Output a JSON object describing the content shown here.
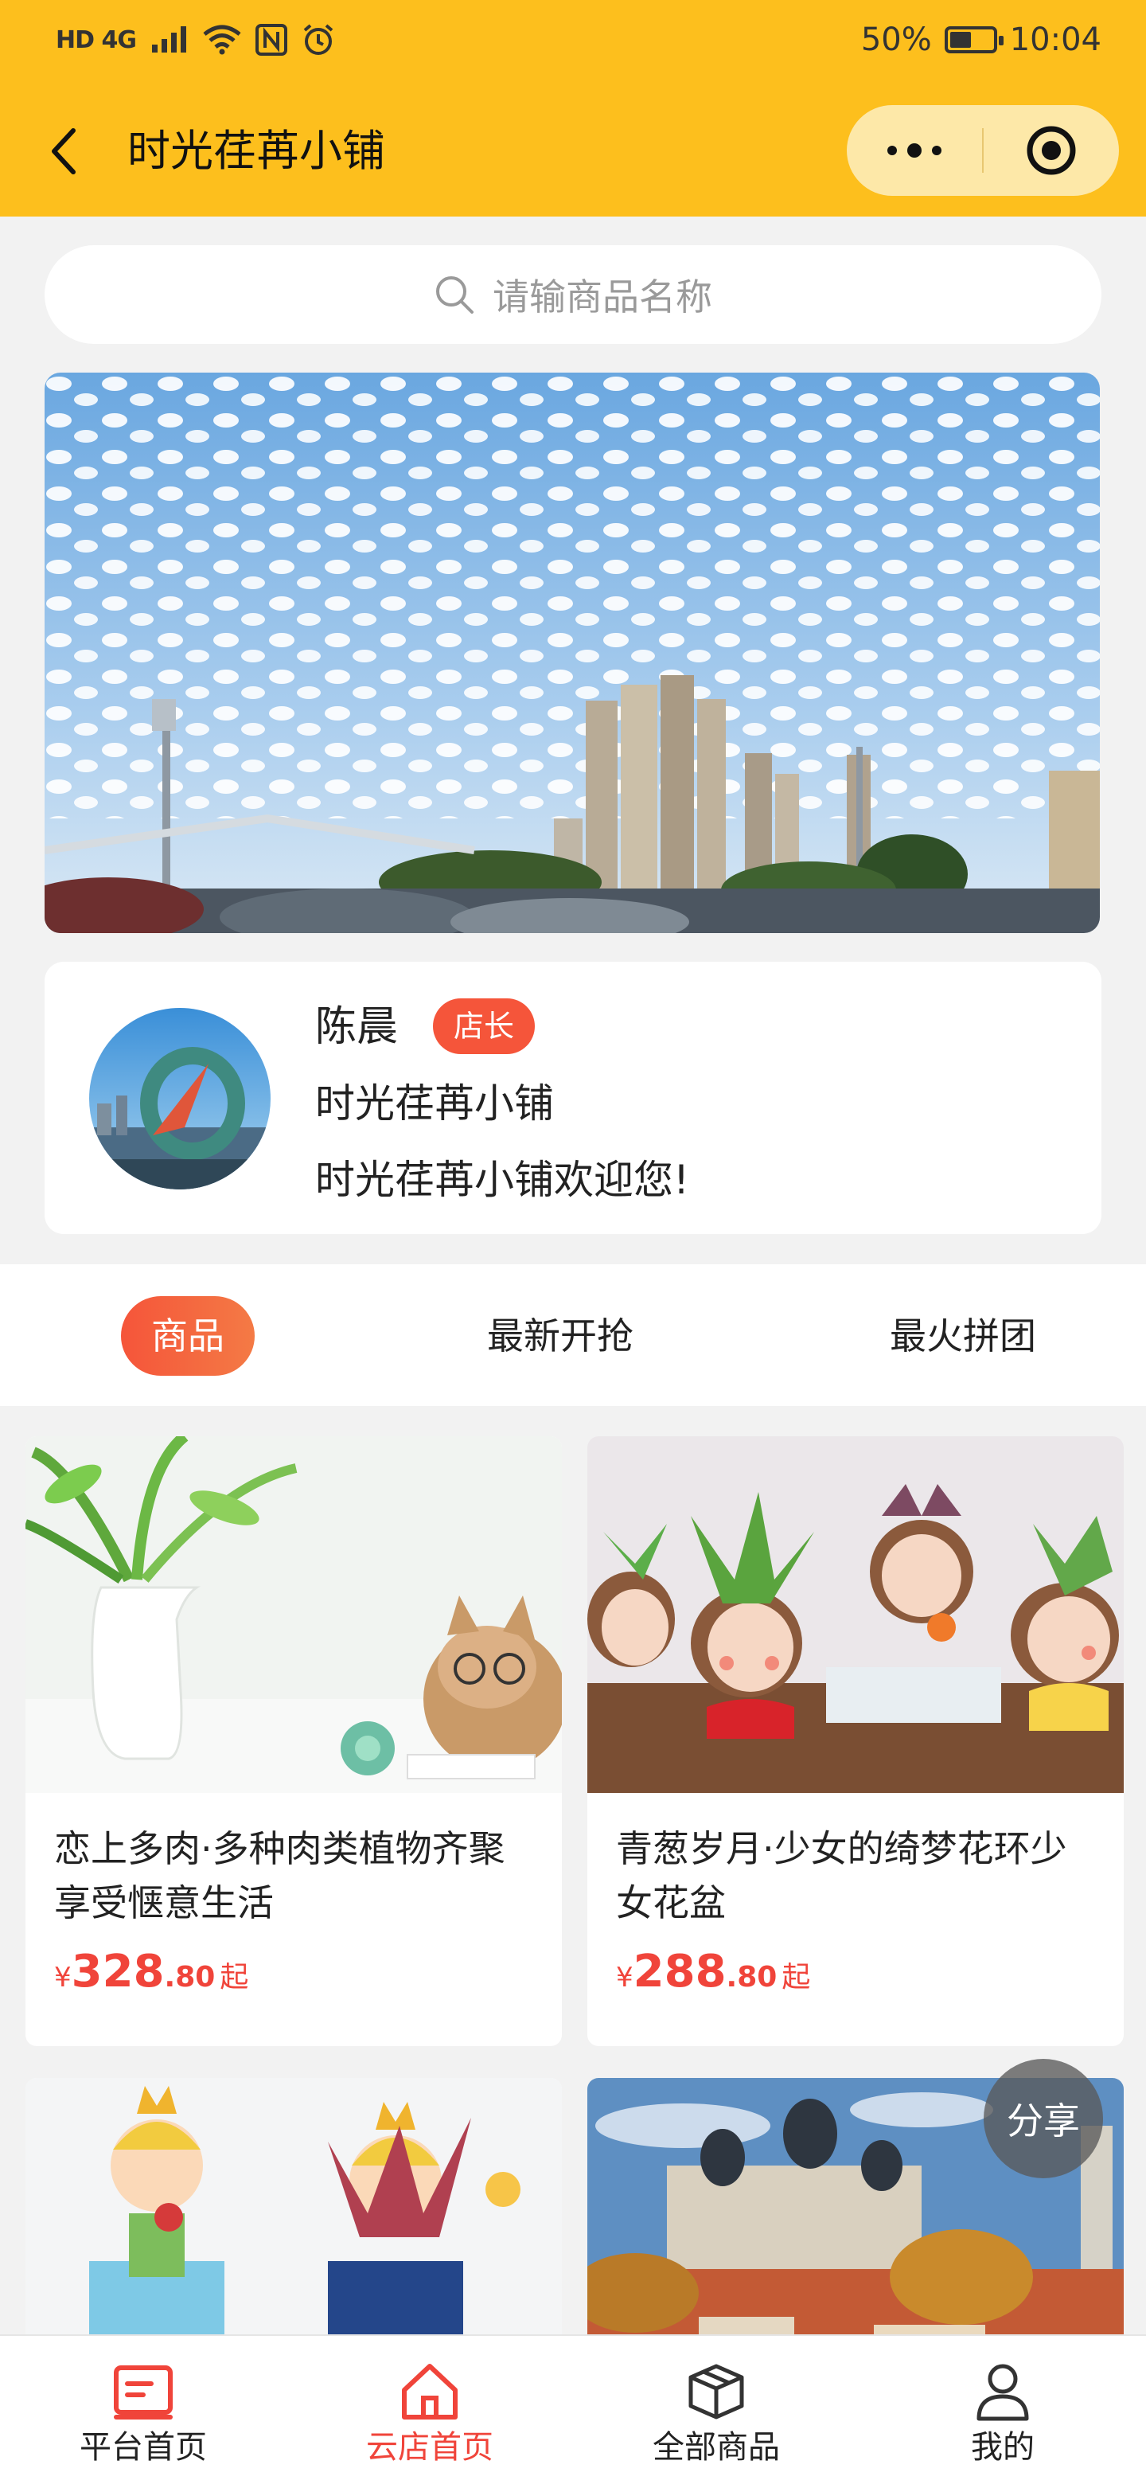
{
  "status_bar": {
    "network": "HD 4G",
    "battery": "50%",
    "battery_level": 0.5,
    "time": "10:04"
  },
  "header": {
    "title": "时光荏苒小铺",
    "back_icon": "chevron-left-icon",
    "menu_icon": "more-dots-icon",
    "close_icon": "target-circle-icon"
  },
  "search": {
    "placeholder": "请输商品名称",
    "icon": "search-icon"
  },
  "shop": {
    "owner_name": "陈晨",
    "owner_badge": "店长",
    "shop_name": "时光荏苒小铺",
    "welcome": "时光荏苒小铺欢迎您!"
  },
  "tabs": [
    {
      "label": "商品",
      "active": true
    },
    {
      "label": "最新开抢",
      "active": false
    },
    {
      "label": "最火拼团",
      "active": false
    }
  ],
  "products": [
    {
      "name": "恋上多肉·多种肉类植物齐聚享受惬意生活",
      "currency": "¥",
      "price_int": "328",
      "price_dec": ".80",
      "price_suffix": "起"
    },
    {
      "name": "青葱岁月·少女的绮梦花环少女花盆",
      "currency": "¥",
      "price_int": "288",
      "price_dec": ".80",
      "price_suffix": "起"
    }
  ],
  "share_label": "分享",
  "bottom_nav": [
    {
      "label": "平台首页",
      "icon": "platform-home-icon",
      "active": false
    },
    {
      "label": "云店首页",
      "icon": "home-icon",
      "active": true
    },
    {
      "label": "全部商品",
      "icon": "box-icon",
      "active": false
    },
    {
      "label": "我的",
      "icon": "user-icon",
      "active": false
    }
  ],
  "colors": {
    "header_bg": "#fdbf1d",
    "accent": "#f0443a",
    "badge": "#f5553a",
    "page_bg": "#f2f2f2"
  }
}
